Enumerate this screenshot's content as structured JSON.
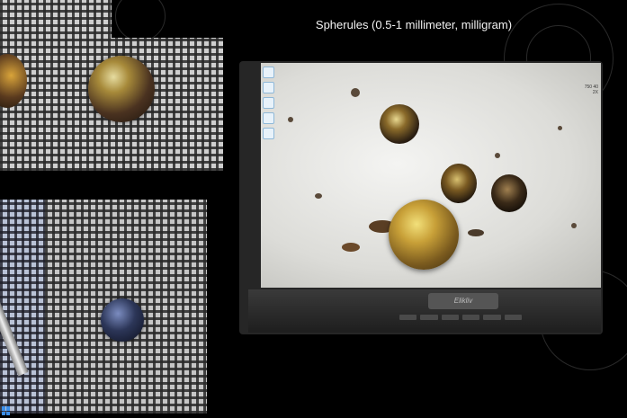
{
  "slide": {
    "title": "Spherules (0.5-1 millimeter, milligram)"
  },
  "monitor": {
    "logo": "Elikliv",
    "readout_line1": "750 40",
    "readout_line2": "2X"
  },
  "icons": {
    "screen_toolbar": [
      "camera-icon",
      "record-icon",
      "settings-icon",
      "gallery-icon",
      "info-icon"
    ],
    "taskbar": "windows-start-icon"
  },
  "colors": {
    "background": "#000000",
    "title_text": "#f2f2f2"
  }
}
